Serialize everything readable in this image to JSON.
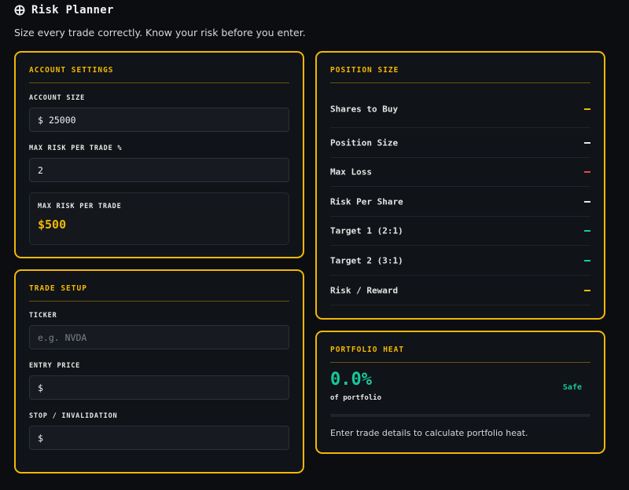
{
  "app": {
    "icon": "crosshair-icon",
    "title": "Risk Planner",
    "subtitle": "Size every trade correctly. Know your risk before you enter."
  },
  "colors": {
    "accent": "#f2b705",
    "positive": "#19c79a",
    "negative": "#e5484d",
    "neutral": "#e6e6e6"
  },
  "account_settings": {
    "title": "ACCOUNT SETTINGS",
    "account_size_label": "ACCOUNT SIZE",
    "account_size_prefix": "$",
    "account_size_value": "25000",
    "max_risk_pct_label": "MAX RISK PER TRADE %",
    "max_risk_pct_value": "2",
    "max_risk_label": "MAX RISK PER TRADE",
    "max_risk_value": "$500"
  },
  "trade_setup": {
    "title": "TRADE SETUP",
    "ticker_label": "TICKER",
    "ticker_placeholder": "e.g. NVDA",
    "entry_label": "ENTRY PRICE",
    "entry_prefix": "$",
    "stop_label": "STOP / INVALIDATION",
    "stop_prefix": "$"
  },
  "position_size": {
    "title": "POSITION SIZE",
    "rows": [
      {
        "label": "Shares to Buy",
        "value": "—",
        "color": "#f2b705"
      },
      {
        "label": "Position Size",
        "value": "—",
        "color": "#e6e6e6"
      },
      {
        "label": "Max Loss",
        "value": "—",
        "color": "#e5484d"
      },
      {
        "label": "Risk Per Share",
        "value": "—",
        "color": "#e6e6e6"
      },
      {
        "label": "Target 1 (2:1)",
        "value": "—",
        "color": "#19c79a"
      },
      {
        "label": "Target 2 (3:1)",
        "value": "—",
        "color": "#19c79a"
      },
      {
        "label": "Risk / Reward",
        "value": "—",
        "color": "#f2b705"
      }
    ]
  },
  "portfolio_heat": {
    "title": "PORTFOLIO HEAT",
    "value": "0.0%",
    "value_label": "of portfolio",
    "status": "Safe",
    "fill_fraction": 0,
    "note": "Enter trade details to calculate portfolio heat."
  }
}
